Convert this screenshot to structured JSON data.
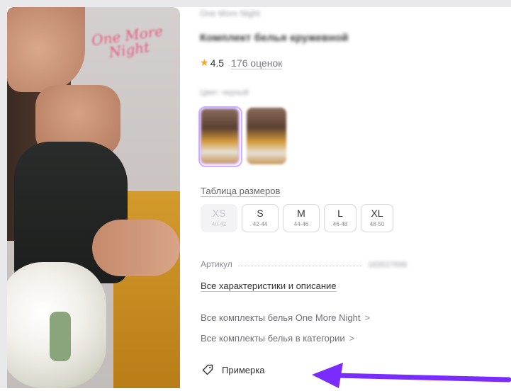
{
  "product": {
    "brand": "One More Night",
    "title": "Комплект белья кружевной",
    "rating": "4.5",
    "reviews": "176 оценок",
    "color_label": "Цвет: черный",
    "article_label": "Артикул",
    "article_value": "183527698"
  },
  "photo": {
    "logo_text": "One More Night"
  },
  "links": {
    "size_table": "Таблица размеров",
    "all_characteristics": "Все характеристики и описание",
    "brand_sets": "Все комплекты белья One More Night",
    "category_sets": "Все комплекты белья в категории",
    "chevron": ">",
    "fitting": "Примерка"
  },
  "sizes": [
    {
      "size": "XS",
      "range": "40-42",
      "available": false
    },
    {
      "size": "S",
      "range": "42-44",
      "available": true
    },
    {
      "size": "M",
      "range": "44-46",
      "available": true
    },
    {
      "size": "L",
      "range": "46-48",
      "available": true
    },
    {
      "size": "XL",
      "range": "48-50",
      "available": true
    }
  ],
  "icons": {
    "rating": "star-icon",
    "fitting": "tag-icon",
    "annotation": "arrow-icon"
  },
  "colors": {
    "accent": "#7a2cff",
    "star": "#f5a524",
    "selected_swatch": "#cba7ff"
  }
}
